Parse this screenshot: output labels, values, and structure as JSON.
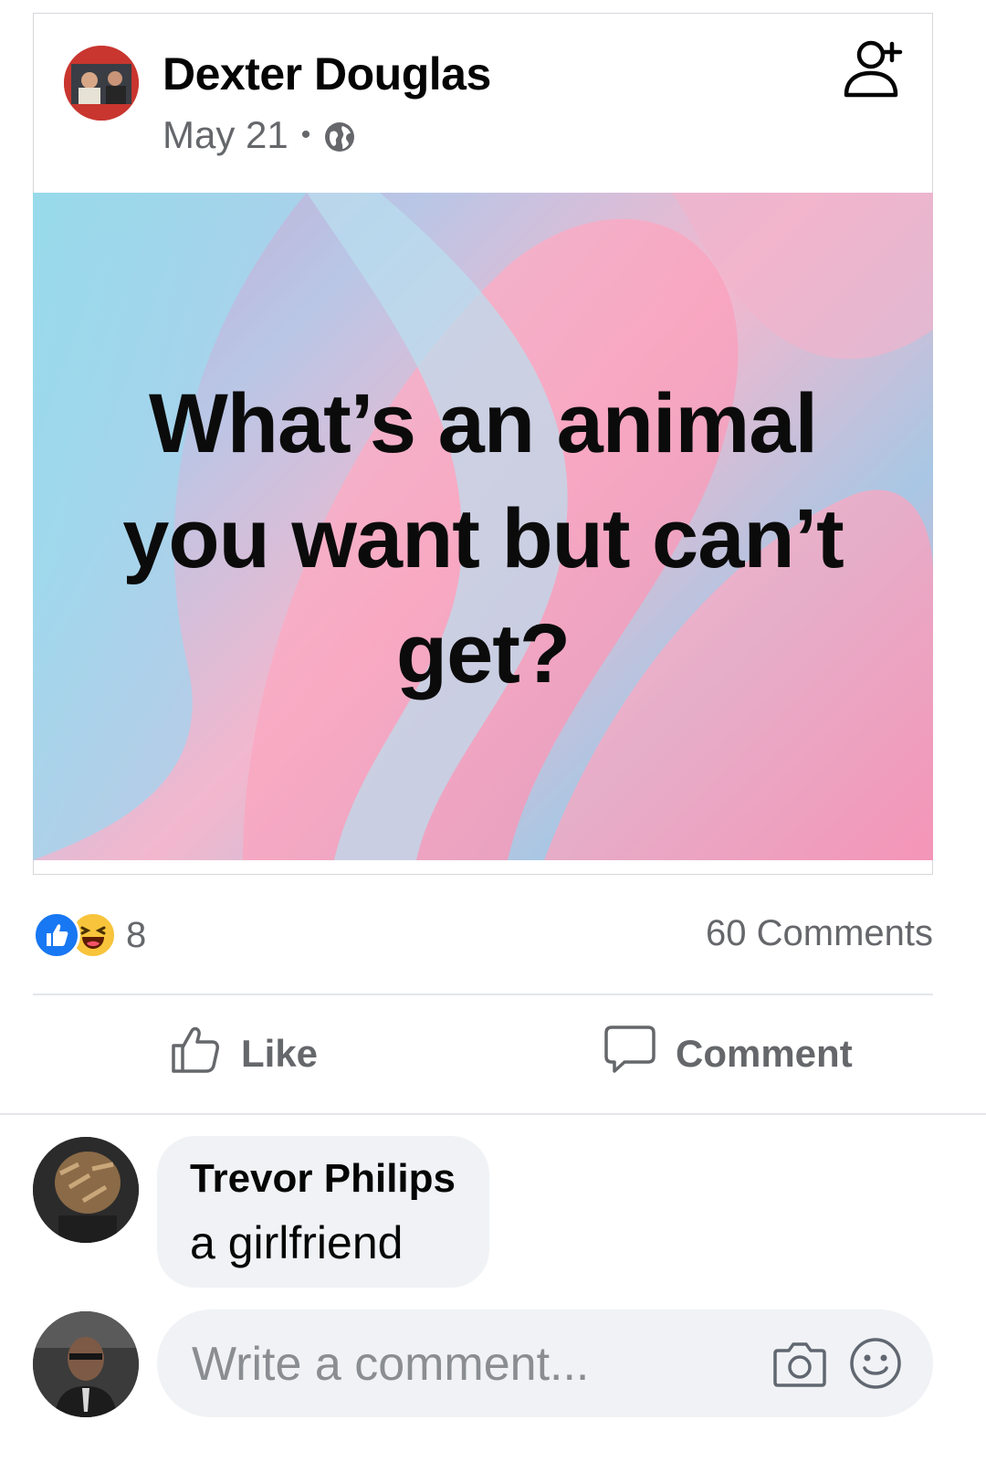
{
  "post": {
    "author": "Dexter Douglas",
    "date": "May 21",
    "separator": "•",
    "privacy_icon": "globe-icon",
    "question": "What’s an animal you want but can’t get?"
  },
  "stats": {
    "reaction_icons": [
      "like-reaction-icon",
      "haha-reaction-icon"
    ],
    "reaction_count": "8",
    "comments_count": "60 Comments"
  },
  "actions": {
    "like_label": "Like",
    "comment_label": "Comment"
  },
  "comment": {
    "author": "Trevor Philips",
    "text": "a girlfriend"
  },
  "composer": {
    "placeholder": "Write a comment..."
  },
  "colors": {
    "name": "#050505",
    "secondary": "#65676b",
    "bubble": "#f0f2f5",
    "like_blue": "#1877f2",
    "haha_yellow": "#f7c43b",
    "divider": "#e4e6eb"
  }
}
